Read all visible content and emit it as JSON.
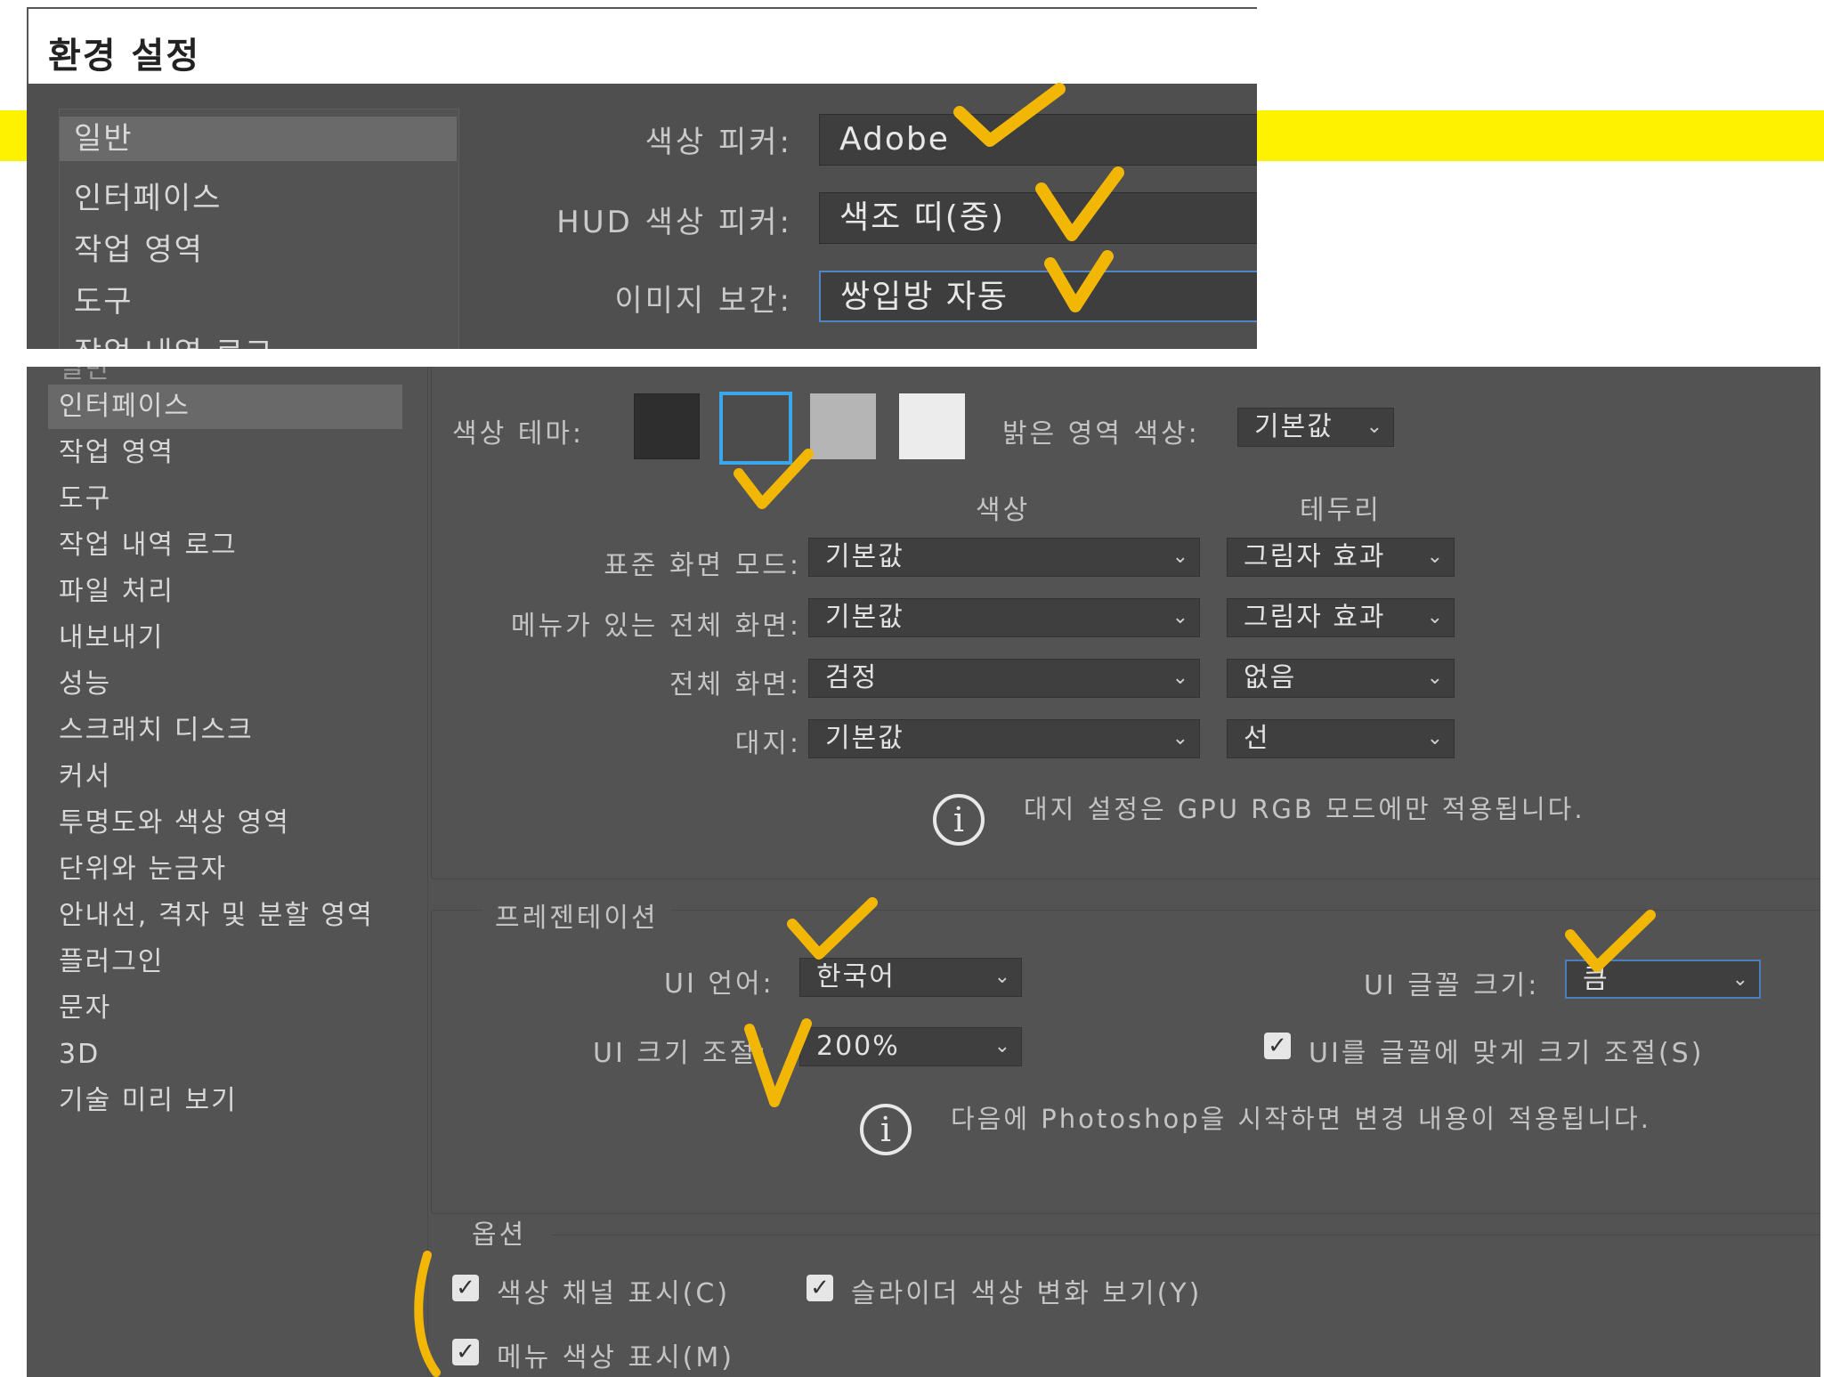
{
  "colors": {
    "highlight_band": "#fff200",
    "annotation_mark": "#f2b705",
    "dialog_bg": "#535353",
    "field_bg": "#3e3e3e",
    "focus_border": "#4f86c6"
  },
  "top": {
    "title": "환경 설정",
    "sidebar": [
      "일반",
      "인터페이스",
      "작업 영역",
      "도구",
      "작업 내역 로그"
    ],
    "rows": [
      {
        "label": "색상 피커:",
        "value": "Adobe"
      },
      {
        "label": "HUD 색상 피커:",
        "value": "색조 띠(중)"
      },
      {
        "label": "이미지 보간:",
        "value": "쌍입방 자동"
      }
    ]
  },
  "bottom": {
    "sidebar_partial": "일반",
    "sidebar": [
      "인터페이스",
      "작업 영역",
      "도구",
      "작업 내역 로그",
      "파일 처리",
      "내보내기",
      "성능",
      "스크래치 디스크",
      "커서",
      "투명도와 색상 영역",
      "단위와 눈금자",
      "안내선, 격자 및 분할 영역",
      "플러그인",
      "문자",
      "3D",
      "기술 미리 보기"
    ],
    "appearance": {
      "color_theme_label": "색상 테마:",
      "theme_swatches": [
        "#2e2e2e",
        "#4c4c4c",
        "#b5b5b5",
        "#ececec"
      ],
      "selected_theme": 2,
      "highlight_label": "밝은 영역 색상:",
      "highlight_value": "기본값",
      "col_color": "색상",
      "col_border": "테두리",
      "rows": [
        {
          "label": "표준 화면 모드:",
          "color": "기본값",
          "border": "그림자 효과"
        },
        {
          "label": "메뉴가 있는 전체 화면:",
          "color": "기본값",
          "border": "그림자 효과"
        },
        {
          "label": "전체 화면:",
          "color": "검정",
          "border": "없음"
        },
        {
          "label": "대지:",
          "color": "기본값",
          "border": "선"
        }
      ],
      "note": "대지 설정은 GPU RGB 모드에만 적용됩니다."
    },
    "presentation": {
      "title": "프레젠테이션",
      "ui_language_label": "UI 언어:",
      "ui_language_value": "한국어",
      "ui_font_size_label": "UI 글꼴 크기:",
      "ui_font_size_value": "큼",
      "ui_scale_label": "UI 크기 조절:",
      "ui_scale_value": "200%",
      "scale_to_font_label": "UI를 글꼴에 맞게 크기 조절(S)",
      "scale_to_font_checked": true,
      "note": "다음에 Photoshop을 시작하면 변경 내용이 적용됩니다."
    },
    "options": {
      "title": "옵션",
      "items": [
        {
          "label": "색상 채널 표시(C)",
          "checked": true
        },
        {
          "label": "슬라이더 색상 변화 보기(Y)",
          "checked": true
        },
        {
          "label": "메뉴 색상 표시(M)",
          "checked": true
        }
      ]
    }
  }
}
